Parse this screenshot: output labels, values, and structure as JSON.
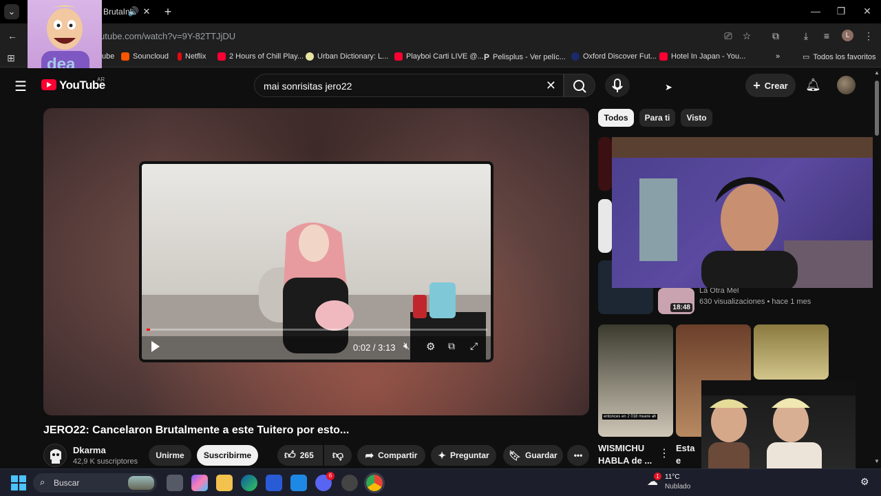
{
  "browser": {
    "tab_title": "BrutaIn",
    "url": "utube.com/watch?v=9Y-82TTJjDU",
    "bookmarks": [
      "ube",
      "Souncloud",
      "Netflix",
      "2 Hours of Chill Play...",
      "Urban Dictionary: L...",
      "Playboi Carti LIVE @...",
      "Pelisplus - Ver pelíc...",
      "Oxford Discover Fut...",
      "Hotel In Japan - You..."
    ],
    "all_bookmarks": "Todos los favoritos",
    "profile_letter": "L"
  },
  "sticker": {
    "text": "dea"
  },
  "youtube": {
    "logo": "YouTube",
    "country": "AR",
    "search_value": "mai sonrisitas jero22",
    "create_label": "Crear",
    "chips": [
      "Todos",
      "Para ti",
      "Visto"
    ],
    "player": {
      "time": "0:02 / 3:13",
      "progress": 0.0104
    },
    "video_title": "JERO22: Cancelaron Brutalmente a este Tuitero por esto...",
    "channel": {
      "name": "Dkarma",
      "subs": "42,9 K suscriptores"
    },
    "actions": {
      "join": "Unirme",
      "subscribe": "Suscribirme",
      "likes": "265",
      "share": "Compartir",
      "ask": "Preguntar",
      "save": "Guardar"
    },
    "recs": {
      "rec3_channel": "La Otra Mel",
      "rec3_meta": "630 visualizaciones • hace 1 mes",
      "rec3_duration": "18:48",
      "rec3_caption": "entonces en 2 018 muere ah",
      "rec4_title": "WISMICHU HABLA de ...",
      "rec5_title": "Esta e Verda"
    }
  },
  "taskbar": {
    "search_label": "Buscar",
    "weather_temp": "11°C",
    "weather_desc": "Nublado",
    "discord_badge": "6",
    "weather_badge": "1"
  },
  "colors": {
    "youtube_red": "#ff0033",
    "bg": "#0f0f0f",
    "chip_active": "#f1f1f1"
  }
}
